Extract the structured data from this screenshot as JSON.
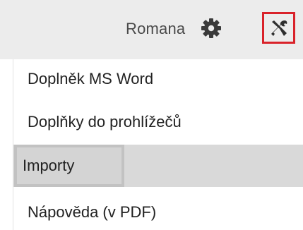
{
  "header": {
    "username": "Romana",
    "settings_icon": "gear-icon",
    "tools_icon": "tools-icon",
    "tools_highlight_color": "#d9222a"
  },
  "menu": {
    "items": [
      {
        "label": "Doplněk MS Word"
      },
      {
        "label": "Doplňky do prohlížečů"
      },
      {
        "label": "Importy",
        "highlighted": true
      },
      {
        "label": "Nápověda (v PDF)"
      }
    ]
  }
}
